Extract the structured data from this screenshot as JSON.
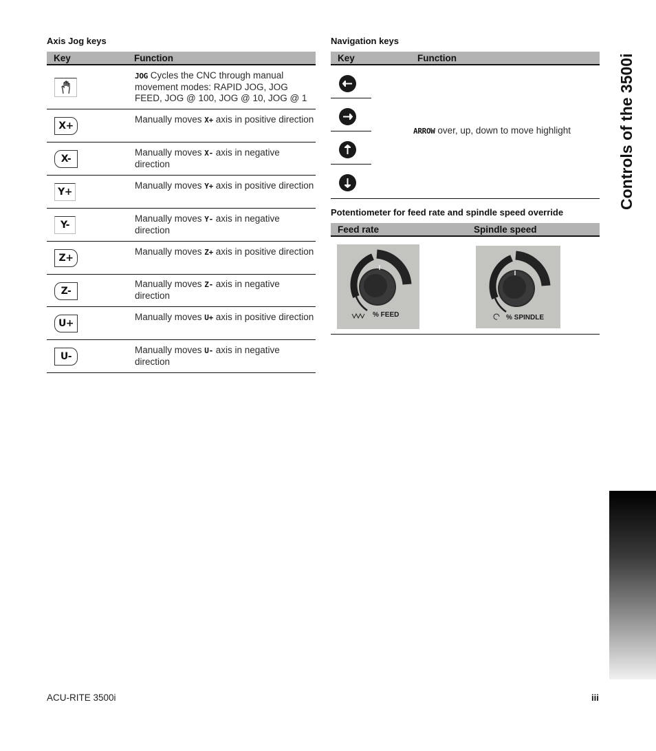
{
  "axis_jog": {
    "title": "Axis Jog keys",
    "header": {
      "key": "Key",
      "function": "Function"
    },
    "rows": [
      {
        "key_icon": "hand-jog-icon",
        "key_label": "",
        "keyword": "JOG",
        "text": " Cycles the CNC through manual movement modes: RAPID JOG, JOG FEED, JOG @ 100, JOG @ 10, JOG @ 1"
      },
      {
        "key_icon": "x-plus-key-icon",
        "key_label": "X+",
        "prefix": "Manually moves ",
        "keyword": "X+",
        "text": " axis in positive direction"
      },
      {
        "key_icon": "x-minus-key-icon",
        "key_label": "X-",
        "prefix": "Manually moves ",
        "keyword": "X-",
        "text": " axis in negative direction"
      },
      {
        "key_icon": "y-plus-key-icon",
        "key_label": "Y+",
        "prefix": "Manually moves ",
        "keyword": "Y+",
        "text": " axis in positive direction"
      },
      {
        "key_icon": "y-minus-key-icon",
        "key_label": "Y-",
        "prefix": "Manually moves ",
        "keyword": "Y-",
        "text": " axis in negative direction"
      },
      {
        "key_icon": "z-plus-key-icon",
        "key_label": "Z+",
        "prefix": "Manually moves ",
        "keyword": "Z+",
        "text": " axis in positive direction"
      },
      {
        "key_icon": "z-minus-key-icon",
        "key_label": "Z-",
        "prefix": "Manually moves ",
        "keyword": "Z-",
        "text": " axis in negative direction"
      },
      {
        "key_icon": "u-plus-key-icon",
        "key_label": "U+",
        "prefix": "Manually moves ",
        "keyword": "U+",
        "text": " axis in positive direction"
      },
      {
        "key_icon": "u-minus-key-icon",
        "key_label": "U-",
        "prefix": "Manually moves ",
        "keyword": "U-",
        "text": " axis in negative direction"
      }
    ]
  },
  "navigation": {
    "title": "Navigation keys",
    "header": {
      "key": "Key",
      "function": "Function"
    },
    "keys": [
      "arrow-left-icon",
      "arrow-right-icon",
      "arrow-up-icon",
      "arrow-down-icon"
    ],
    "keyword": "ARROW",
    "text": " over, up, down to move highlight"
  },
  "potentiometer": {
    "title": "Potentiometer for feed rate and spindle speed override",
    "header": {
      "feed": "Feed rate",
      "spindle": "Spindle speed"
    },
    "feed_label": "% FEED",
    "spindle_label": "% SPINDLE"
  },
  "side_tab": {
    "title": "Controls of the 3500i"
  },
  "footer": {
    "product": "ACU-RITE 3500i",
    "page": "iii"
  },
  "colors": {
    "header_gray": "#b3b3b3",
    "panel_gray": "#c3c4bf",
    "text": "#1a1a1a"
  }
}
